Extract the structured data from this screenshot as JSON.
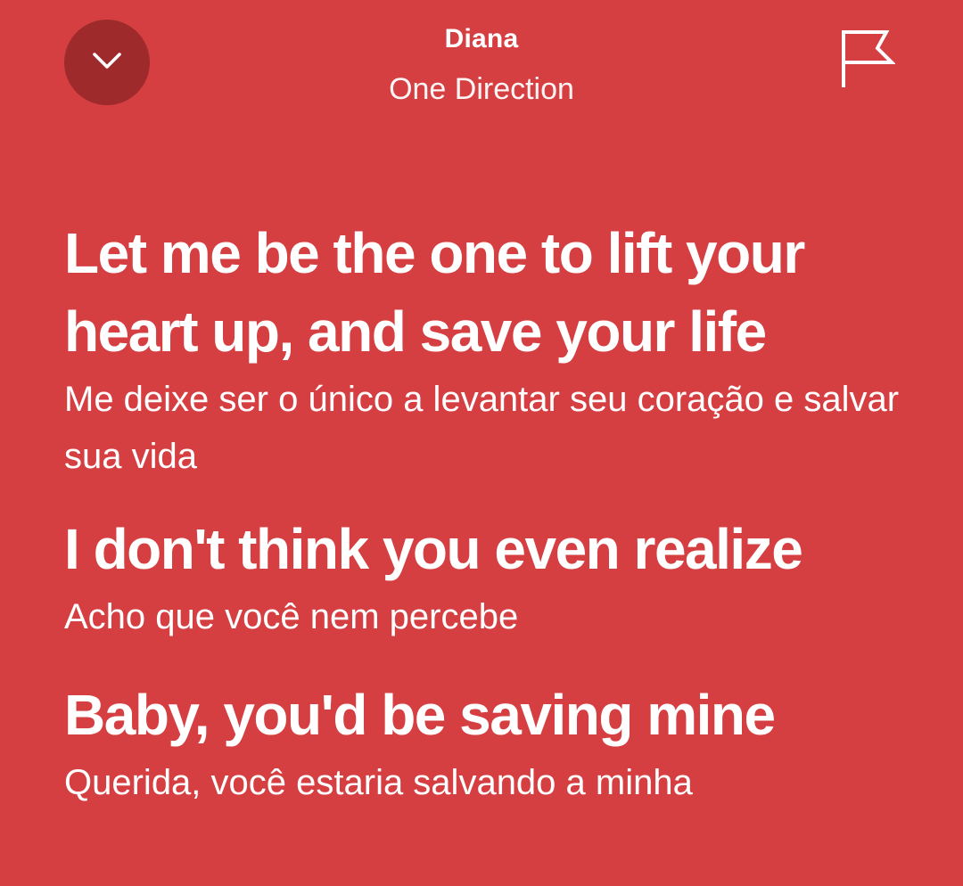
{
  "header": {
    "collapse_icon": "chevron-down-icon",
    "title": "Diana",
    "artist": "One Direction",
    "report_icon": "flag-icon"
  },
  "lyrics": [
    {
      "line": "Let me be the one to lift your heart up, and save your life",
      "translation": "Me deixe ser o único a levantar seu coração e salvar sua vida"
    },
    {
      "line": "I don't think you even realize",
      "translation": "Acho que você nem percebe"
    },
    {
      "line": "Baby, you'd be saving mine",
      "translation": "Querida, você estaria salvando a minha"
    }
  ],
  "colors": {
    "background": "#d63f42",
    "collapse_button": "#9e2a2c",
    "text": "#ffffff"
  }
}
